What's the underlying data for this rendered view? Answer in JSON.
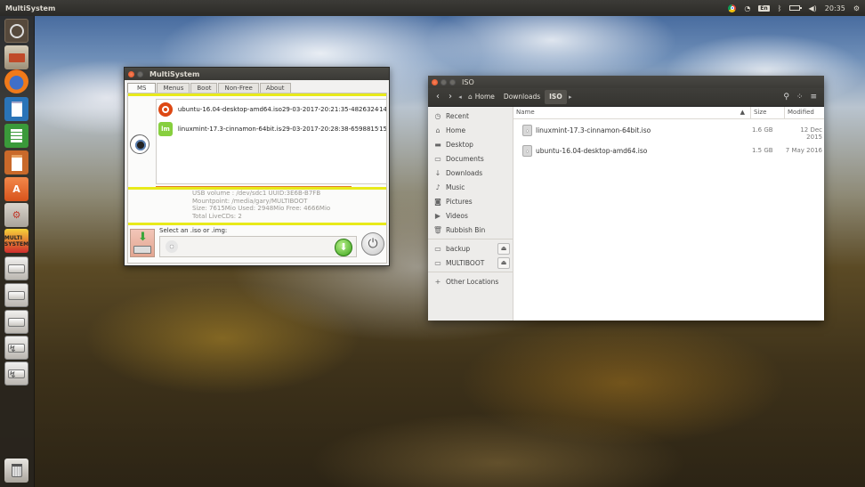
{
  "top_panel": {
    "app_title": "MultiSystem",
    "keyboard": "En",
    "time": "20:35"
  },
  "launcher": {
    "items": [
      "dash-icon",
      "files-icon",
      "firefox-icon",
      "writer-icon",
      "calc-icon",
      "impress-icon",
      "software-center-icon",
      "settings-icon",
      "multisystem-icon",
      "drive-icon",
      "drive-icon",
      "drive-icon",
      "usb-drive-icon",
      "usb-drive-icon",
      "trash-icon"
    ],
    "multisystem_label": "MULTI SYSTEM"
  },
  "multisystem": {
    "title": "MultiSystem",
    "tabs": [
      "MS",
      "Menus",
      "Boot",
      "Non-Free",
      "About"
    ],
    "active_tab": "MS",
    "isos": [
      {
        "name": "ubuntu-16.04-desktop-amd64.iso",
        "date": "29-03-2017-20:21:35-482632463",
        "extra": "14",
        "icon": "ubuntu-icon"
      },
      {
        "name": "linuxmint-17.3-cinnamon-64bit.iso",
        "date": "29-03-2017-20:28:38-659881598",
        "extra": "15",
        "icon": "linuxmint-icon"
      }
    ],
    "info": {
      "line1": "USB volume : /dev/sdc1 UUID:3E6B-B7FB",
      "line2": "Mountpoint: /media/gary/MULTIBOOT",
      "line3": "Size: 7615Mio Used: 2948Mio Free: 4666Mio",
      "line4": "Total LiveCDs: 2"
    },
    "select_label": "Select an .iso or .img:",
    "iso_input_value": "",
    "accent_color": "#e8ea1a"
  },
  "files": {
    "title": "ISO",
    "breadcrumbs": [
      "Home",
      "Downloads",
      "ISO"
    ],
    "sidebar": {
      "places": [
        "Recent",
        "Home",
        "Desktop",
        "Documents",
        "Downloads",
        "Music",
        "Pictures",
        "Videos",
        "Rubbish Bin"
      ],
      "devices": [
        "backup",
        "MULTIBOOT"
      ],
      "other": "Other Locations"
    },
    "columns": {
      "name": "Name",
      "size": "Size",
      "modified": "Modified"
    },
    "rows": [
      {
        "name": "linuxmint-17.3-cinnamon-64bit.iso",
        "size": "1.6 GB",
        "modified": "12 Dec 2015"
      },
      {
        "name": "ubuntu-16.04-desktop-amd64.iso",
        "size": "1.5 GB",
        "modified": "7 May 2016"
      }
    ]
  }
}
